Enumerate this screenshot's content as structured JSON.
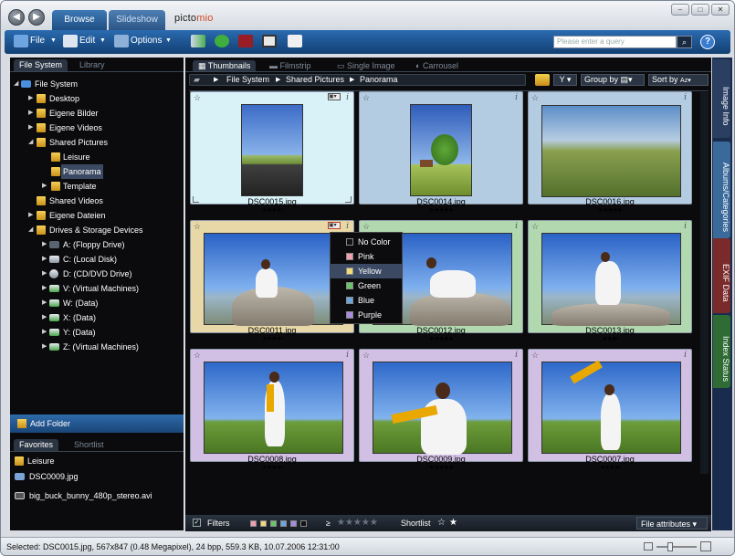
{
  "app": {
    "title_prefix": "picto",
    "title_accent": "mio"
  },
  "tabs": [
    {
      "label": "Browse"
    },
    {
      "label": "Slideshow"
    }
  ],
  "toolbar": {
    "file": "File",
    "edit": "Edit",
    "options": "Options"
  },
  "search": {
    "placeholder": "Please enter a query"
  },
  "left_tabs": [
    {
      "label": "File System"
    },
    {
      "label": "Library"
    }
  ],
  "tree": [
    {
      "label": "File System"
    },
    {
      "label": "Desktop"
    },
    {
      "label": "Eigene Bilder"
    },
    {
      "label": "Eigene Videos"
    },
    {
      "label": "Shared Pictures"
    },
    {
      "label": "Leisure"
    },
    {
      "label": "Panorama"
    },
    {
      "label": "Template"
    },
    {
      "label": "Shared Videos"
    },
    {
      "label": "Eigene Dateien"
    },
    {
      "label": "Drives & Storage Devices"
    },
    {
      "label": "A: (Floppy Drive)"
    },
    {
      "label": "C: (Local Disk)"
    },
    {
      "label": "D: (CD/DVD Drive)"
    },
    {
      "label": "V: (Virtual Machines)"
    },
    {
      "label": "W: (Data)"
    },
    {
      "label": "X: (Data)"
    },
    {
      "label": "Y: (Data)"
    },
    {
      "label": "Z: (Virtual Machines)"
    }
  ],
  "add_folder": "Add Folder",
  "fav_tabs": [
    {
      "label": "Favorites"
    },
    {
      "label": "Shortlist"
    }
  ],
  "favorites": [
    {
      "label": "Leisure"
    },
    {
      "label": "DSC0009.jpg"
    },
    {
      "label": "big_buck_bunny_480p_stereo.avi"
    }
  ],
  "view_tabs": [
    {
      "label": "Thumbnails"
    },
    {
      "label": "Filmstrip"
    },
    {
      "label": "Single Image"
    },
    {
      "label": "Carrousel"
    }
  ],
  "breadcrumb": [
    "File System",
    "Shared Pictures",
    "Panorama"
  ],
  "view_controls": {
    "group_by": "Group by",
    "sort_by": "Sort by"
  },
  "right_tabs": [
    {
      "label": "Image Info"
    },
    {
      "label": "Albums/Categories"
    },
    {
      "label": "EXIF Data"
    },
    {
      "label": "Index Status"
    }
  ],
  "thumbnails": [
    {
      "name": "DSC0015.jpg",
      "stars": "★★★★•",
      "color": "#d8f2f8"
    },
    {
      "name": "DSC0014.jpg",
      "stars": "★★★★★",
      "color": "#b4cce2"
    },
    {
      "name": "DSC0016.jpg",
      "stars": "★★★★★",
      "color": "#b4cce2"
    },
    {
      "name": "DSC0011.jpg",
      "stars": "★★★★•",
      "color": "#e8d8a8"
    },
    {
      "name": "DSC0012.jpg",
      "stars": "★★★★★",
      "color": "#b2d8b0"
    },
    {
      "name": "DSC0013.jpg",
      "stars": "★★★•",
      "color": "#b2d8b0"
    },
    {
      "name": "DSC0008.jpg",
      "stars": "★★★★•",
      "color": "#d2bfe4"
    },
    {
      "name": "DSC0009.jpg",
      "stars": "★★★★★",
      "color": "#d2bfe4"
    },
    {
      "name": "DSC0007.jpg",
      "stars": "★★★★•",
      "color": "#d2bfe4"
    }
  ],
  "color_menu": [
    {
      "label": "No Color",
      "color": "#111111"
    },
    {
      "label": "Pink",
      "color": "#f2a0ae"
    },
    {
      "label": "Yellow",
      "color": "#f2dc7a"
    },
    {
      "label": "Green",
      "color": "#6cc46a"
    },
    {
      "label": "Blue",
      "color": "#6aa6e0"
    },
    {
      "label": "Purple",
      "color": "#a88ce0"
    }
  ],
  "bottom_bar": {
    "filters": "Filters",
    "ge": "≥",
    "rating_stars": "★★★★★",
    "shortlist": "Shortlist",
    "file_attributes": "File attributes"
  },
  "status": {
    "text": "Selected: DSC0015.jpg, 567x847 (0.48 Megapixel), 24 bpp, 559.3 KB, 10.07.2006 12:31:00"
  }
}
